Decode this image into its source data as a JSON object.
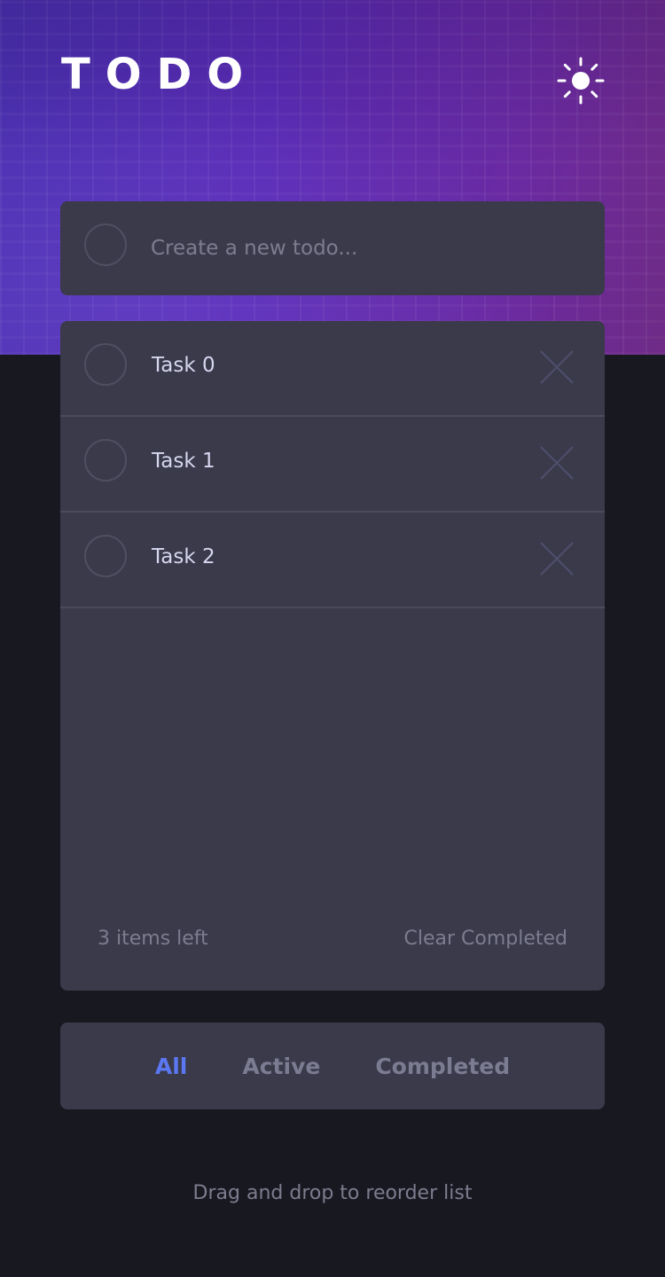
{
  "app": {
    "title": "TODO"
  },
  "header": {
    "theme_toggle_icon": "sun-icon"
  },
  "new_todo": {
    "placeholder": "Create a new todo..."
  },
  "todos": [
    {
      "label": "Task 0",
      "completed": false
    },
    {
      "label": "Task 1",
      "completed": false
    },
    {
      "label": "Task 2",
      "completed": false
    }
  ],
  "footer": {
    "items_left": "3 items left",
    "clear_completed": "Clear Completed"
  },
  "filters": {
    "all": "All",
    "active": "Active",
    "completed": "Completed",
    "selected": "All"
  },
  "hint": "Drag and drop to reorder list",
  "colors": {
    "background": "#181820",
    "card": "#3a3a4b",
    "accent": "#5b77f1",
    "text": "#d6d7ef",
    "muted": "#7c7c8f"
  }
}
